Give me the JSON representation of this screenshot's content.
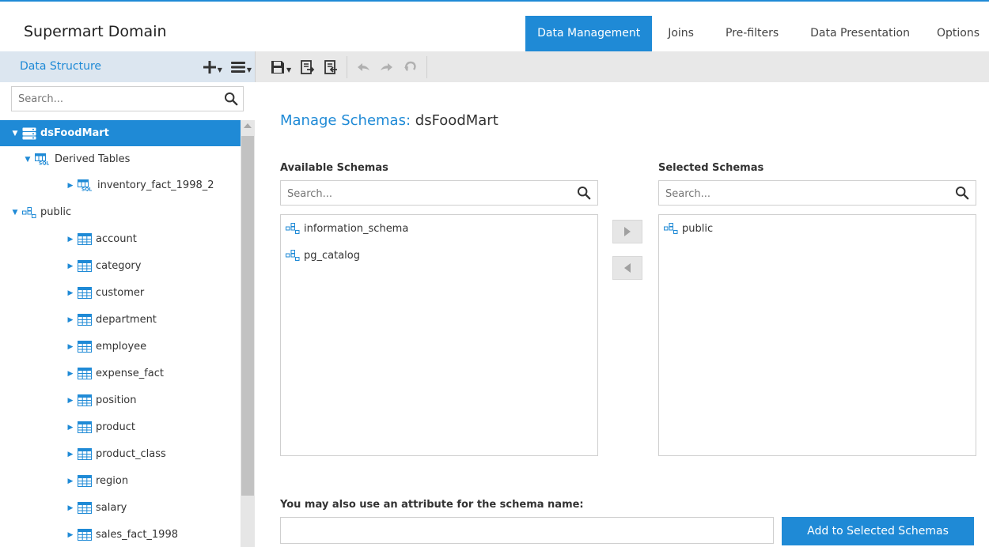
{
  "app": {
    "title": "Supermart Domain"
  },
  "tabs": [
    {
      "label": "Data Management",
      "active": true
    },
    {
      "label": "Joins",
      "active": false
    },
    {
      "label": "Pre-filters",
      "active": false
    },
    {
      "label": "Data Presentation",
      "active": false
    },
    {
      "label": "Options",
      "active": false
    }
  ],
  "sidebar": {
    "title": "Data Structure",
    "search_placeholder": "Search...",
    "tree": [
      {
        "label": "dsFoodMart",
        "icon": "database-icon",
        "level": 0,
        "expanded": true,
        "selected": true
      },
      {
        "label": "Derived Tables",
        "icon": "derived-tables-icon",
        "level": 1,
        "expanded": true
      },
      {
        "label": "inventory_fact_1998_2",
        "icon": "sql-table-icon",
        "level": 2,
        "expanded": false
      },
      {
        "label": "public",
        "icon": "schema-icon",
        "level": 0,
        "expanded": true
      },
      {
        "label": "account",
        "icon": "table-icon",
        "level": 2,
        "expanded": false
      },
      {
        "label": "category",
        "icon": "table-icon",
        "level": 2,
        "expanded": false
      },
      {
        "label": "customer",
        "icon": "table-icon",
        "level": 2,
        "expanded": false
      },
      {
        "label": "department",
        "icon": "table-icon",
        "level": 2,
        "expanded": false
      },
      {
        "label": "employee",
        "icon": "table-icon",
        "level": 2,
        "expanded": false
      },
      {
        "label": "expense_fact",
        "icon": "table-icon",
        "level": 2,
        "expanded": false
      },
      {
        "label": "position",
        "icon": "table-icon",
        "level": 2,
        "expanded": false
      },
      {
        "label": "product",
        "icon": "table-icon",
        "level": 2,
        "expanded": false
      },
      {
        "label": "product_class",
        "icon": "table-icon",
        "level": 2,
        "expanded": false
      },
      {
        "label": "region",
        "icon": "table-icon",
        "level": 2,
        "expanded": false
      },
      {
        "label": "salary",
        "icon": "table-icon",
        "level": 2,
        "expanded": false
      },
      {
        "label": "sales_fact_1998",
        "icon": "table-icon",
        "level": 2,
        "expanded": false
      }
    ]
  },
  "toolbar": {
    "tools": [
      "add-icon",
      "menu-icon",
      "save-icon",
      "export-icon",
      "import-icon",
      "undo-icon",
      "redo-icon",
      "revert-icon"
    ]
  },
  "main": {
    "title_prefix": "Manage Schemas:",
    "title_name": "dsFoodMart",
    "available": {
      "label": "Available Schemas",
      "search_placeholder": "Search...",
      "items": [
        "information_schema",
        "pg_catalog"
      ]
    },
    "selected": {
      "label": "Selected Schemas",
      "search_placeholder": "Search...",
      "items": [
        "public"
      ]
    },
    "attribute_label": "You may also use an attribute for the schema name:",
    "attribute_value": "",
    "add_button": "Add to Selected Schemas"
  },
  "colors": {
    "accent": "#1f8ad6",
    "sidebar_header": "#dce6f0",
    "toolbar": "#e8e8e8"
  }
}
